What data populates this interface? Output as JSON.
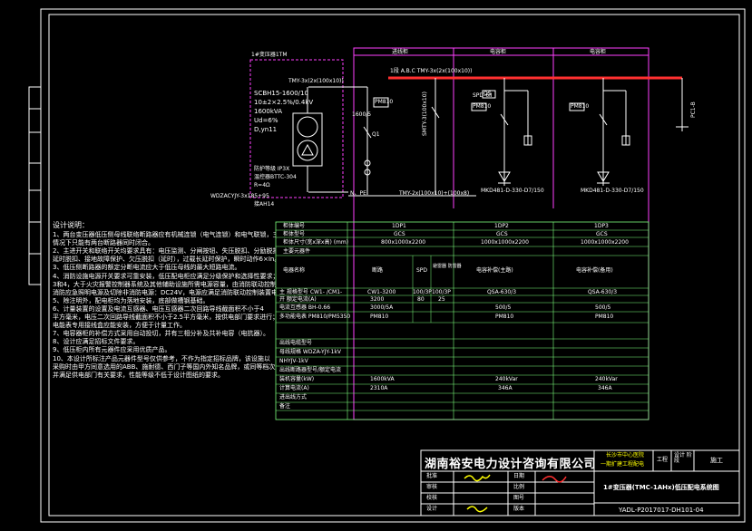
{
  "transformer": {
    "header": "1#变压器1TM",
    "model": "SCBH15-1600/10",
    "ratio": "10±2×2.5%/0.4kV",
    "capacity": "1600kVA",
    "uk": "Ud=6%",
    "group": "D,yn11",
    "protect_label": "防护等级 IP3X",
    "temp_label": "温控器BTTC-304",
    "r": "R=4Ω",
    "busbar_left": "TMY-3x(2x(100x10))",
    "ct": "1600/5",
    "pm": "PM810",
    "q1": "Q1",
    "cable": "WDZACYJY-3x185+95",
    "cable2": "接AH14",
    "npe": "N、PE",
    "busbar_n": "TMY-2x(100x10)+(100x8)"
  },
  "bus": {
    "main": "1段 A.B.C TMY-3x(2x(100x10))",
    "tmy_v": "SMTY-3(100x10)"
  },
  "column_headers": [
    "进线柜",
    "电容柜",
    "电容柜"
  ],
  "panels": {
    "p2_top": "QS",
    "p2_ct": "SPD-6II",
    "p2_pm": "PM810",
    "p2_cap": "MKD481-D-330-D7/150",
    "p3_pm": "PM810",
    "p3_cap": "MKD481-D-330-D7/150",
    "end_label": "PC1-B"
  },
  "table": {
    "rows": [
      {
        "label": "柜体编号",
        "v1": "1DP1",
        "v2": "1DP2",
        "v3": "1DP3"
      },
      {
        "label": "柜体型号",
        "v1": "GCS",
        "v2": "GCS",
        "v3": "GCS"
      },
      {
        "label": "柜体尺寸(宽x深x高) (mm)",
        "v1": "800x1000x2200",
        "v2": "1000x1000x2200",
        "v3": "1000x1000x2200"
      }
    ],
    "section_main": "主要元器件",
    "device_label": "电器名称",
    "device_cols": [
      "断路",
      "SPD",
      "避雷器 防雷器",
      "电容补偿(主路)",
      "电容补偿(备用)"
    ],
    "rows2": [
      {
        "label": "主 规格型号 CW1- /CM1-",
        "v1": "CW1-3200",
        "v2": "100/3P",
        "v3": "100/3P",
        "v4": "QSA-630/3",
        "v5": "QSA-630/3"
      },
      {
        "label": "开 额定电流(A)",
        "v1": "3200",
        "v2": "80",
        "v3": "25",
        "v4": "",
        "v5": ""
      },
      {
        "label": "电流互感器 BH-0.66",
        "v1": "3000/5A",
        "v2": "",
        "v3": "",
        "v4": "500/5",
        "v5": "500/5"
      },
      {
        "label": "多功能电表 PM810/PM5350",
        "v1": "PM810",
        "v2": "",
        "v3": "",
        "v4": "PM810",
        "v5": "PM810"
      }
    ],
    "rows3": [
      {
        "label": "出线电缆型号",
        "v": ""
      },
      {
        "label": "母线规格 WDZA-YJY-1kV",
        "v": ""
      },
      {
        "label": "NHYJV-1kV",
        "v": ""
      },
      {
        "label": "出线断路器型号/额定电流",
        "v": ""
      }
    ],
    "rows4": [
      {
        "label": "装机容量(kW)",
        "v1": "1600kVA",
        "v2": "240kVar",
        "v3": "240kVar"
      },
      {
        "label": "计算电流(A)",
        "v1": "2310A",
        "v2": "346A",
        "v3": "346A"
      },
      {
        "label": "进出线方式",
        "v1": "",
        "v2": "",
        "v3": ""
      },
      {
        "label": "备注",
        "v1": "",
        "v2": "",
        "v3": ""
      }
    ]
  },
  "notes": {
    "title": "设计说明：",
    "lines": [
      "1、两台变压器低压侧母线联络断路器应有机械连锁（电气连锁）和电气联锁，三台断路器任何",
      "    情况下只能有两台断路器同时闭合。",
      "2、主进开关和联络开关均要求具有：电压监测、分闸按钮、失压脱扣、分励脱扣、短路瞬时保护、",
      "    延时脱扣、接地故障保护、欠压脱扣（延时），过载长延时保护，瞬时动作6×In。",
      "3、低压侧断路器的额定分断电流应大于低压母线的最大短路电流。",
      "4、消防设施电源开关要求可靠安装，低压配电柜应满足分级保护和选择性要求；",
      "    3和4，大于火灾报警控制器系统及其他辅助设施所需电源容量，由消防联动控制分励脱扣跳闸。",
      "    消防应急照明电源及切除非消防电源：DC24V，电源应满足消防联动控制装置电源要求。",
      "5、除注明外，配电柜均为落地安装，底部做槽钢基础。",
      "6、计量装置的设置及电流互感器、电压互感器二次回路导线截面积不小于4",
      "    平方毫米，电压二次回路导线截面积不小于2.5平方毫米，按供电部门要求进行；",
      "    电能表专用接线盒应能安装，方便于计量工作。",
      "7、电容器柜的补偿方式采用自动投切，并有三相分补及共补电容（电抗器）。",
      "8、设计应满足招标文件要求。",
      "9、低压柜内所有元器件应采用优质产品。",
      "10、本设计所标注产品元器件型号仅供参考，不作为指定招标品牌，该设施以",
      "    采购时由甲方同意选用的ABB、施耐德、西门子等国内外知名品牌，或同等档次产品，",
      "    并满足供电部门有关要求，性能等级不低于设计图纸的要求。"
    ]
  },
  "titleblock": {
    "company": "湖南裕安电力设计咨询有限公司",
    "project_line1": "长沙市中心医院",
    "project_line2": "一期扩建工程配电",
    "phase_label": "工程",
    "stage_label": "设计 阶段",
    "stage_value": "施工",
    "roles": [
      "批准",
      "审核",
      "校核",
      "设计"
    ],
    "roles2": [
      "日期",
      "比例",
      "图号",
      "版本"
    ],
    "drawing_title": "1#变压器(TMC-1AHx)低压配电系统图",
    "drawing_no": "YADL-P2017017-DH101-04"
  }
}
